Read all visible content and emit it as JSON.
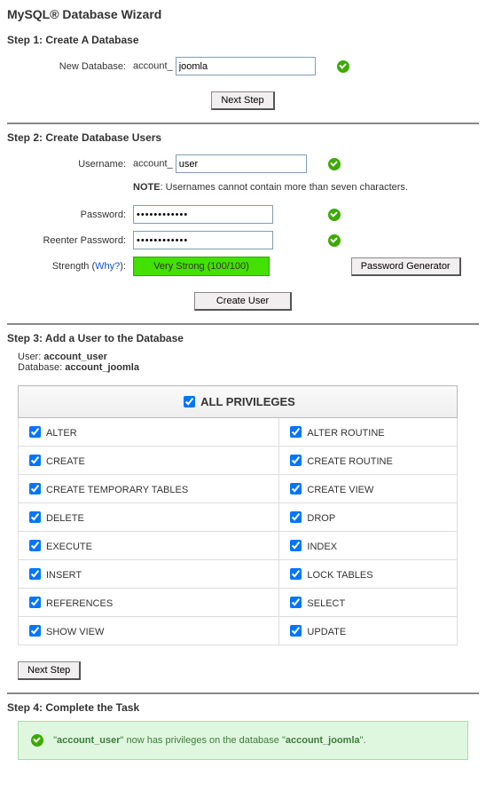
{
  "title": "MySQL® Database Wizard",
  "step1": {
    "heading": "Step 1: Create A Database",
    "newdb_label": "New Database:",
    "prefix": "account_",
    "value": "joomla",
    "next_button": "Next Step"
  },
  "step2": {
    "heading": "Step 2: Create Database Users",
    "username_label": "Username:",
    "username_prefix": "account_",
    "username_value": "user",
    "note_bold": "NOTE",
    "note_text": ": Usernames cannot contain more than seven characters.",
    "password_label": "Password:",
    "password_value": "••••••••••••",
    "reenter_label": "Reenter Password:",
    "reenter_value": "••••••••••••",
    "strength_label_a": "Strength (",
    "strength_why": "Why?",
    "strength_label_b": "):",
    "strength_text": "Very Strong (100/100)",
    "passgen_button": "Password Generator",
    "create_user_button": "Create User"
  },
  "step3": {
    "heading": "Step 3: Add a User to the Database",
    "user_label": "User: ",
    "user_value": "account_user",
    "db_label": "Database: ",
    "db_value": "account_joomla",
    "all_priv": "ALL PRIVILEGES",
    "next_button": "Next Step",
    "privileges_left": [
      "ALTER",
      "CREATE",
      "CREATE TEMPORARY TABLES",
      "DELETE",
      "EXECUTE",
      "INSERT",
      "REFERENCES",
      "SHOW VIEW"
    ],
    "privileges_right": [
      "ALTER ROUTINE",
      "CREATE ROUTINE",
      "CREATE VIEW",
      "DROP",
      "INDEX",
      "LOCK TABLES",
      "SELECT",
      "UPDATE"
    ]
  },
  "step4": {
    "heading": "Step 4: Complete the Task",
    "msg_a": "\"",
    "user": "account_user",
    "msg_b": "\" now has privileges on the database \"",
    "db": "account_joomla",
    "msg_c": "\"."
  }
}
